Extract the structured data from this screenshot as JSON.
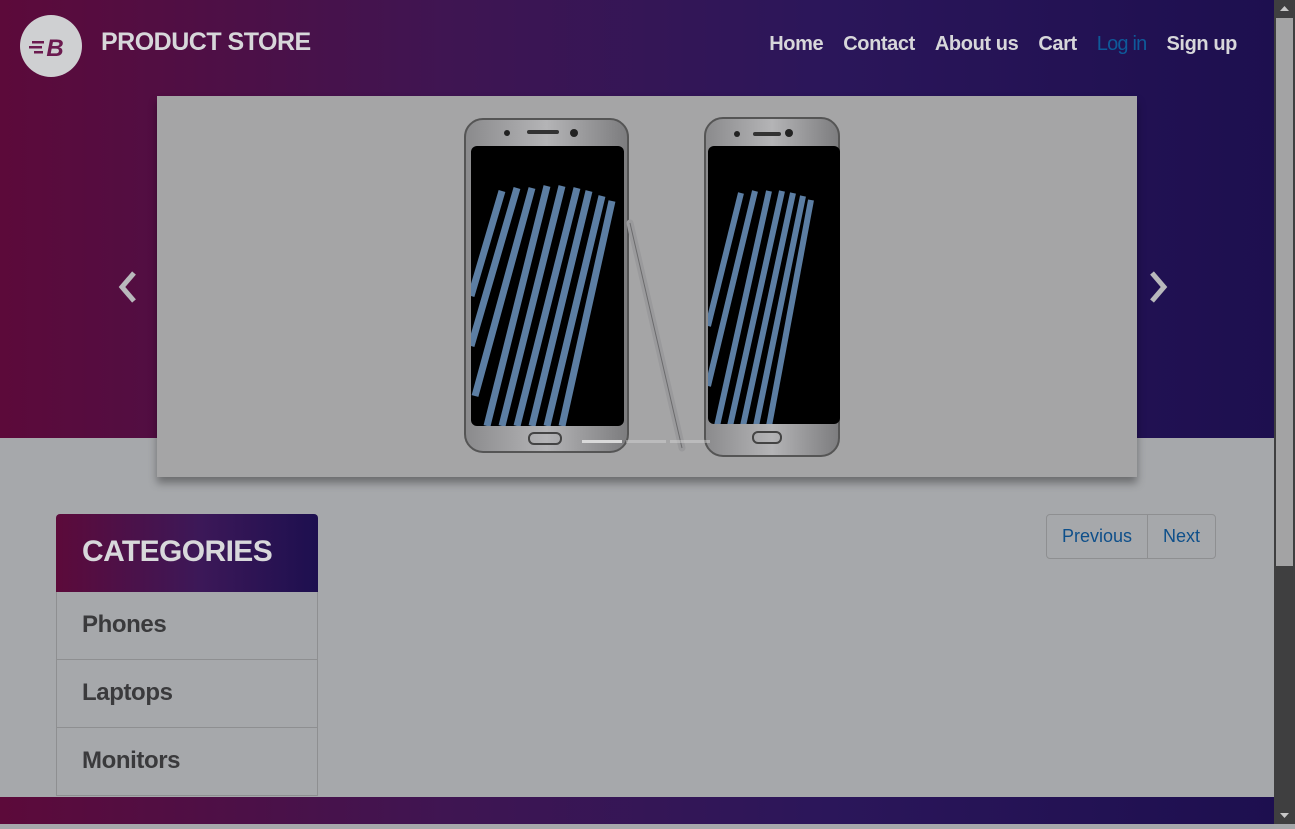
{
  "brand": {
    "name": "PRODUCT STORE",
    "logo_letter": "B"
  },
  "nav": {
    "items": [
      "Home",
      "Contact",
      "About us",
      "Cart",
      "Log in",
      "Sign up"
    ]
  },
  "carousel": {
    "image_icon": "samsung-galaxy-note7-icon",
    "active_index": 0,
    "slide_count": 3
  },
  "categories": {
    "title": "CATEGORIES",
    "items": [
      "Phones",
      "Laptops",
      "Monitors"
    ]
  },
  "pagination": {
    "previous": "Previous",
    "next": "Next"
  },
  "colors": {
    "gradient_start": "#5c0a3a",
    "gradient_end": "#1d0f4f",
    "link": "#0e4f8a"
  }
}
